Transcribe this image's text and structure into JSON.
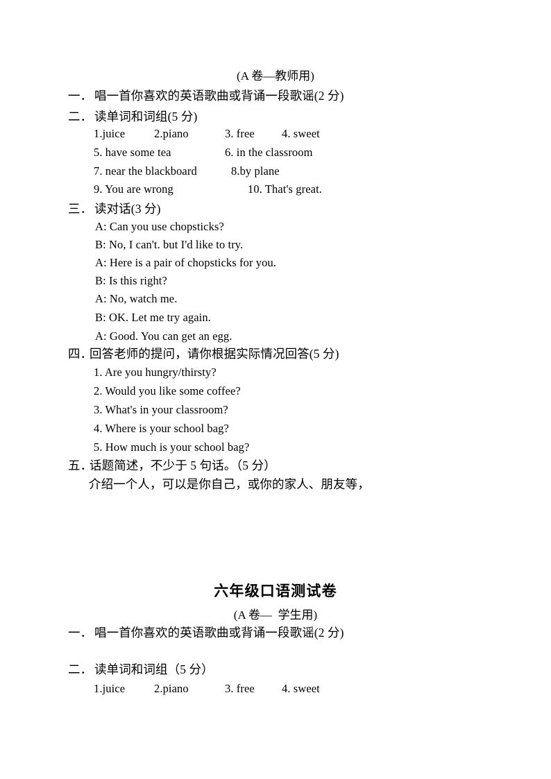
{
  "document": {
    "paper_a_teacher": {
      "header": "(A 卷—教师用)",
      "sections": [
        {
          "number": "一．",
          "title": "唱一首你喜欢的英语歌曲或背诵一段歌谣(2 分)"
        },
        {
          "number": "二．",
          "title": "读单词和词组(5 分)",
          "word_rows": [
            [
              "1.juice",
              "2.piano",
              "3. free",
              "4. sweet"
            ],
            [
              "5. have some tea",
              "6. in the classroom"
            ],
            [
              "7. near the blackboard",
              "8.by plane"
            ],
            [
              "9. You are wrong",
              "10. That's great."
            ]
          ]
        },
        {
          "number": "三．",
          "title": "读对话(3 分)",
          "dialog": [
            "A: Can you use chopsticks?",
            "B: No, I can't. but I'd like to try.",
            "A: Here is a pair of chopsticks for you.",
            "B: Is this right?",
            "A: No, watch me.",
            "B: OK. Let me try again.",
            "A: Good. You can get an egg."
          ]
        },
        {
          "number": "四．",
          "title": "回答老师的提问，请你根据实际情况回答(5 分)",
          "questions": [
            "1. Are you hungry/thirsty?",
            "2. Would you like some coffee?",
            "3. What's in your classroom?",
            "4. Where is your school bag?",
            "5. How much is your school bag?"
          ]
        },
        {
          "number": "五．",
          "title": "话题简述，不少于 5 句话。（5 分）",
          "prompt": "介绍一个人，可以是你自己，或你的家人、朋友等，"
        }
      ]
    },
    "paper_a_student": {
      "title": "六年级口语测试卷",
      "header": "(A 卷—  学生用)",
      "sections": [
        {
          "number": "一．",
          "title": "唱一首你喜欢的英语歌曲或背诵一段歌谣(2 分)"
        },
        {
          "number": "二．",
          "title": "读单词和词组（5 分）",
          "word_rows": [
            [
              "1.juice",
              "2.piano",
              "3. free",
              "4. sweet"
            ]
          ]
        }
      ]
    }
  }
}
